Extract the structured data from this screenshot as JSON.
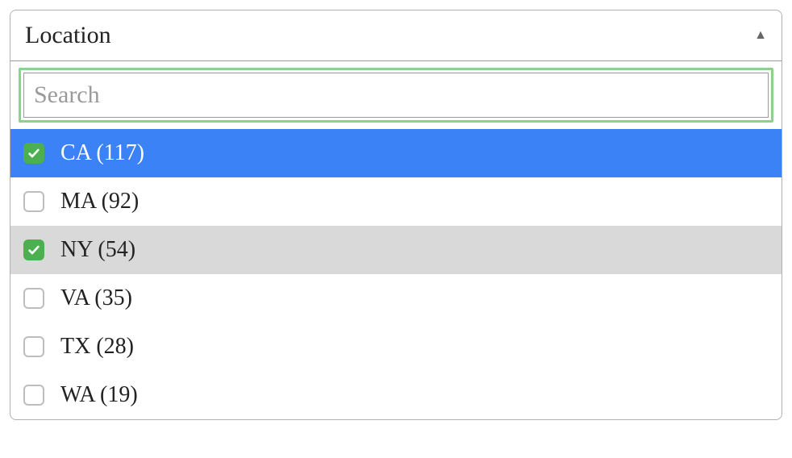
{
  "dropdown": {
    "label": "Location",
    "search_placeholder": "Search",
    "search_value": "",
    "options": [
      {
        "label": "CA (117)",
        "checked": true,
        "selected": true,
        "hover": false
      },
      {
        "label": "MA (92)",
        "checked": false,
        "selected": false,
        "hover": false
      },
      {
        "label": "NY (54)",
        "checked": true,
        "selected": false,
        "hover": true
      },
      {
        "label": "VA (35)",
        "checked": false,
        "selected": false,
        "hover": false
      },
      {
        "label": "TX (28)",
        "checked": false,
        "selected": false,
        "hover": false
      },
      {
        "label": "WA (19)",
        "checked": false,
        "selected": false,
        "hover": false
      }
    ]
  }
}
